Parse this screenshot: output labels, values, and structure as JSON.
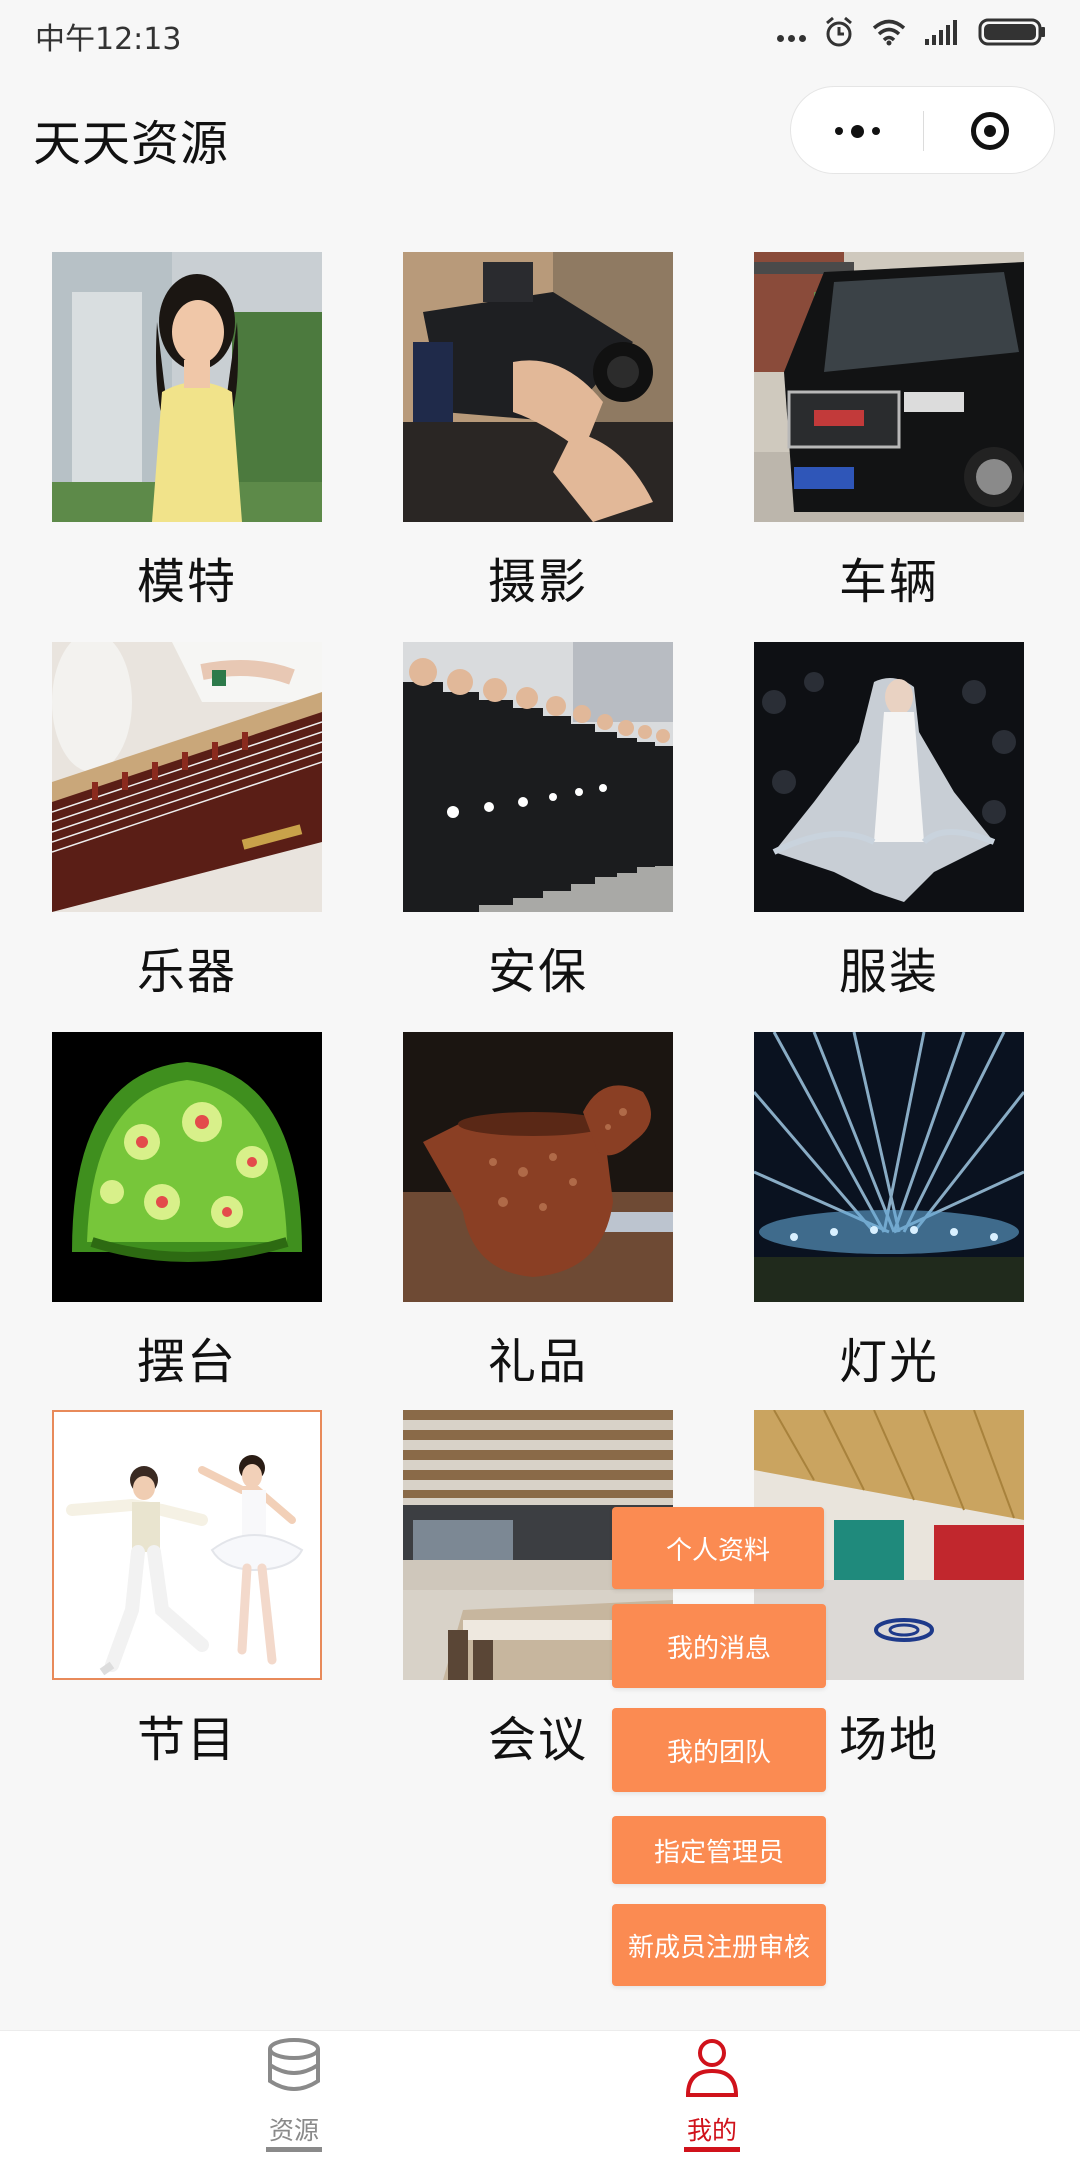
{
  "status_bar": {
    "time": "中午12:13"
  },
  "header": {
    "title": "天天资源"
  },
  "categories": [
    {
      "label": "模特"
    },
    {
      "label": "摄影"
    },
    {
      "label": "车辆"
    },
    {
      "label": "乐器"
    },
    {
      "label": "安保"
    },
    {
      "label": "服装"
    },
    {
      "label": "摆台"
    },
    {
      "label": "礼品"
    },
    {
      "label": "灯光"
    },
    {
      "label": "节目"
    },
    {
      "label": "会议"
    },
    {
      "label": "场地"
    }
  ],
  "popup_menu": {
    "items": [
      {
        "label": "个人资料"
      },
      {
        "label": "我的消息"
      },
      {
        "label": "我的团队"
      },
      {
        "label": "指定管理员"
      },
      {
        "label": "新成员注册审核"
      }
    ]
  },
  "tabbar": {
    "tabs": [
      {
        "label": "资源",
        "icon": "database-icon",
        "active": false
      },
      {
        "label": "我的",
        "icon": "user-icon",
        "active": true
      }
    ]
  },
  "colors": {
    "accent": "#d0121b",
    "menu_bg": "#fb8b52",
    "inactive_tab": "#8a8a8a"
  }
}
